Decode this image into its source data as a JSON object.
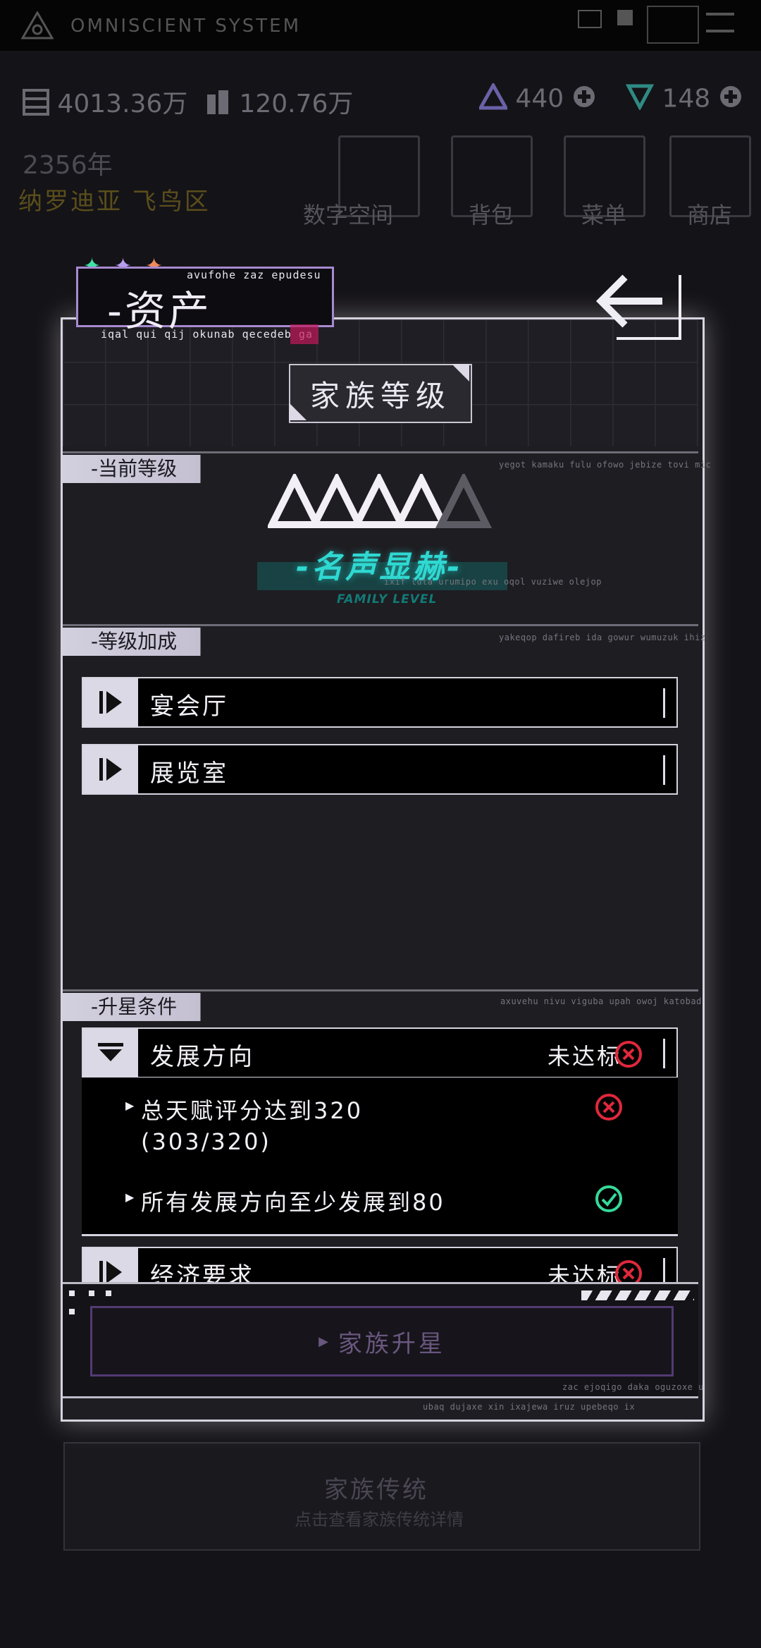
{
  "status_bar": {
    "title": "OMNISCIENT SYSTEM"
  },
  "resources": {
    "money": "4013.36万",
    "secondary": "120.76万",
    "gems_a": "440",
    "gems_b": "148"
  },
  "background": {
    "year": "2356年",
    "location": "纳罗迪亚 飞鸟区",
    "menu": [
      {
        "label": "数字空间"
      },
      {
        "label": "背包"
      },
      {
        "label": "菜单"
      },
      {
        "label": "商店"
      }
    ],
    "bottom_title": "家族传统",
    "bottom_subtitle": "点击查看家族传统详情"
  },
  "modal": {
    "tag_title": "-资产",
    "tag_caption_top": "avufohe zaz epudesu",
    "tag_caption_bottom": "iqal qui qij okunab qecedeb ga",
    "title": "家族等级",
    "sections": {
      "current_level": "-当前等级",
      "level_bonus": "-等级加成",
      "upgrade_conditions": "-升星条件"
    },
    "section_captions": {
      "current_level": "yegot kamaku fulu ofowo jebize tovi mic",
      "level_bonus": "yakeqop dafireb ida gowur wumuzuk ihiz",
      "upgrade_conditions": "axuvehu nivu viguba upah owoj katobad"
    },
    "level": {
      "filled_stars": 4,
      "total_stars": 5,
      "name": "-名声显赫-",
      "caption": "ixif luta urumipo exu oqol vuziwe olejop",
      "sub": "FAMILY LEVEL"
    },
    "bonus_rows": [
      {
        "label": "宴会厅"
      },
      {
        "label": "展览室"
      }
    ],
    "conditions": [
      {
        "label": "发展方向",
        "status": "未达标",
        "expanded": true,
        "items": [
          {
            "line1": "总天赋评分达到320",
            "line2": "(303/320)",
            "met": false
          },
          {
            "line1": "所有发展方向至少发展到80",
            "line2": "",
            "met": true
          }
        ]
      },
      {
        "label": "经济要求",
        "status": "未达标",
        "expanded": false
      }
    ],
    "star_button": "家族升星",
    "bottom_caption_1": "zac ejoqigo daka oguzoxe u",
    "bottom_caption_2": "ubaq dujaxe xin ixajewa iruz upebeqo ix"
  },
  "colors": {
    "accent_cyan": "#2fd9d2",
    "error_red": "#e0283c",
    "ok_green": "#35d99a",
    "tag_border": "#a78ad0"
  }
}
